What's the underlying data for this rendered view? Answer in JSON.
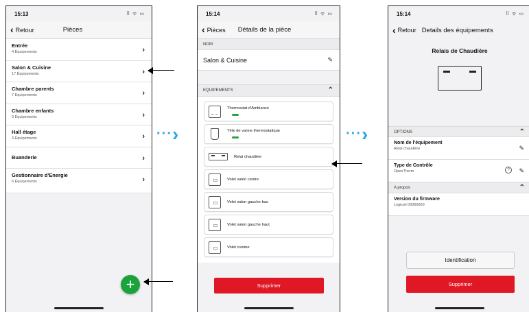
{
  "screen1": {
    "time": "15:13",
    "status_icons": "⠿ ᯤ ▭",
    "back_label": "Retour",
    "title": "Pièces",
    "rooms": [
      {
        "name": "Entrée",
        "sub": "4 Équipements"
      },
      {
        "name": "Salon & Cuisine",
        "sub": "17 Équipements"
      },
      {
        "name": "Chambre parents",
        "sub": "7 Équipements"
      },
      {
        "name": "Chambre enfants",
        "sub": "3 Équipements"
      },
      {
        "name": "Hall étage",
        "sub": "3 Équipements"
      },
      {
        "name": "Buanderie",
        "sub": ""
      },
      {
        "name": "Gestionnaire d'Energie",
        "sub": "6 Équipements"
      }
    ],
    "fab_label": "+"
  },
  "screen2": {
    "time": "15:14",
    "status_icons": "⠿ ᯤ ▭",
    "back_label": "Pièces",
    "title": "Détails de la pièce",
    "name_header": "NOM",
    "room_name": "Salon & Cuisine",
    "equip_header": "EQUIPEMENTS",
    "equipments": [
      {
        "name": "Thermostat d'Ambiance",
        "icon": "thermostat-icon",
        "status": "ok"
      },
      {
        "name": "Tête de vanne thermostatique",
        "icon": "valve-icon",
        "status": "ok"
      },
      {
        "name": "Relai chaudière",
        "icon": "relay-icon",
        "status": ""
      },
      {
        "name": "Volet salon centre",
        "icon": "shutter-icon",
        "status": ""
      },
      {
        "name": "Volet salon gauche bas",
        "icon": "shutter-icon",
        "status": ""
      },
      {
        "name": "Volet salon gauche haut",
        "icon": "shutter-icon",
        "status": ""
      },
      {
        "name": "Volet cuisine",
        "icon": "shutter-icon",
        "status": ""
      }
    ],
    "delete_label": "Supprimer"
  },
  "screen3": {
    "time": "15:14",
    "status_icons": "⠿ ᯤ ▭",
    "back_label": "Retour",
    "title": "Details des équipements",
    "device_title": "Relais de Chaudière",
    "options_header": "OPTIONS",
    "equip_name_label": "Nom de l'équipement",
    "equip_name_value": "Relai chaudière",
    "control_type_label": "Type de Contrôle",
    "control_type_value": "OpenTherm",
    "about_header": "A propos",
    "firmware_label": "Version du firmware",
    "firmware_value": "Logiciel 00060600",
    "identify_label": "Identification",
    "delete_label": "Supprimer"
  },
  "colors": {
    "green": "#1aa33a",
    "red": "#e01724",
    "cyan_arrow": "#2aa9e0"
  }
}
